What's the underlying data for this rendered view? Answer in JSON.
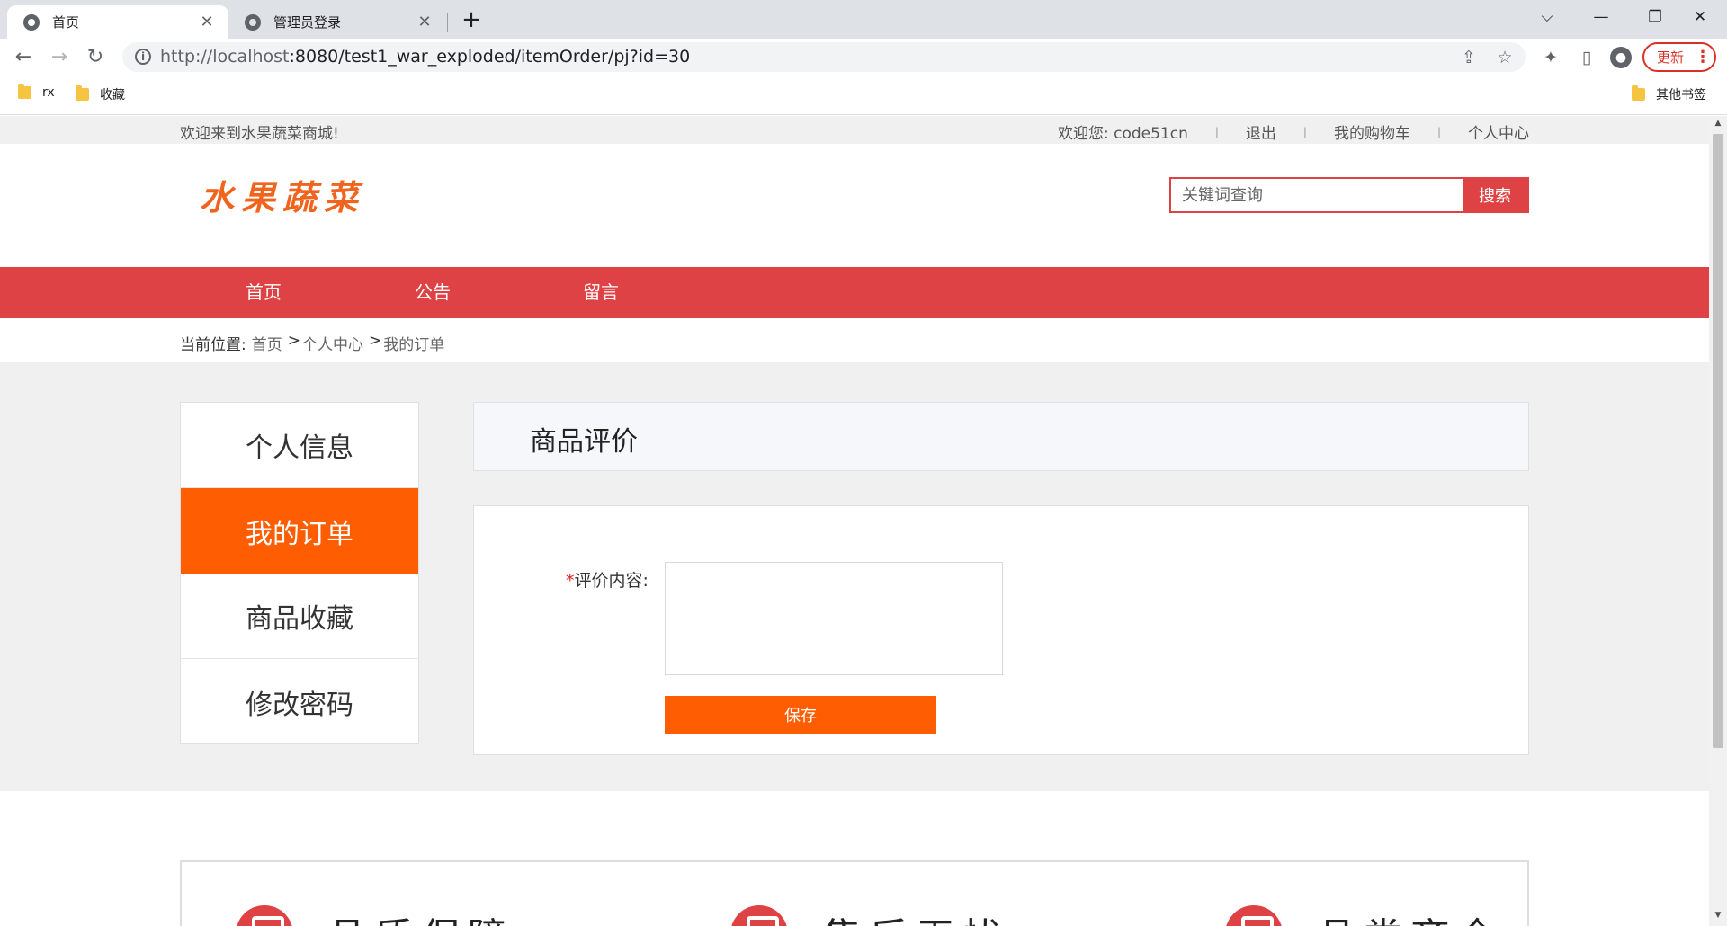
{
  "browser": {
    "tabs": [
      {
        "title": "首页",
        "close": "✕",
        "active": true
      },
      {
        "title": "管理员登录",
        "close": "✕",
        "active": false
      }
    ],
    "new_tab": "+",
    "window_controls": {
      "dropdown": "⌵",
      "minimize": "—",
      "restore": "❐",
      "close": "✕"
    },
    "nav": {
      "back": "←",
      "forward": "→",
      "reload": "↻"
    },
    "url_host": "http://localhost",
    "url_rest": ":8080/test1_war_exploded/itemOrder/pj?id=30",
    "update_label": "更新",
    "bookmarks": [
      "rx",
      "收藏"
    ],
    "other_bookmarks": "其他书签"
  },
  "site": {
    "welcome": "欢迎来到水果蔬菜商城!",
    "user_greeting": "欢迎您:  code51cn",
    "logout": "退出",
    "cart": "我的购物车",
    "profile": "个人中心",
    "link_sep": "|",
    "logo": "水果蔬菜",
    "search_placeholder": "关键词查询",
    "search_button": "搜索",
    "nav": [
      "首页",
      "公告",
      "留言"
    ],
    "breadcrumb": {
      "prefix": "当前位置:",
      "items": [
        "首页",
        "个人中心",
        "我的订单"
      ],
      "sep": ">"
    },
    "side_menu": [
      "个人信息",
      "我的订单",
      "商品收藏",
      "修改密码"
    ],
    "side_menu_active": 1,
    "panel_title": "商品评价",
    "form": {
      "required_mark": "*",
      "label": "评价内容:",
      "value": "",
      "save": "保存"
    },
    "features": [
      "品质保障",
      "售后无忧",
      "品类齐全"
    ]
  },
  "colors": {
    "accent_red": "#df4244",
    "accent_orange": "#ff5d02",
    "logo_orange": "#f0641e"
  }
}
